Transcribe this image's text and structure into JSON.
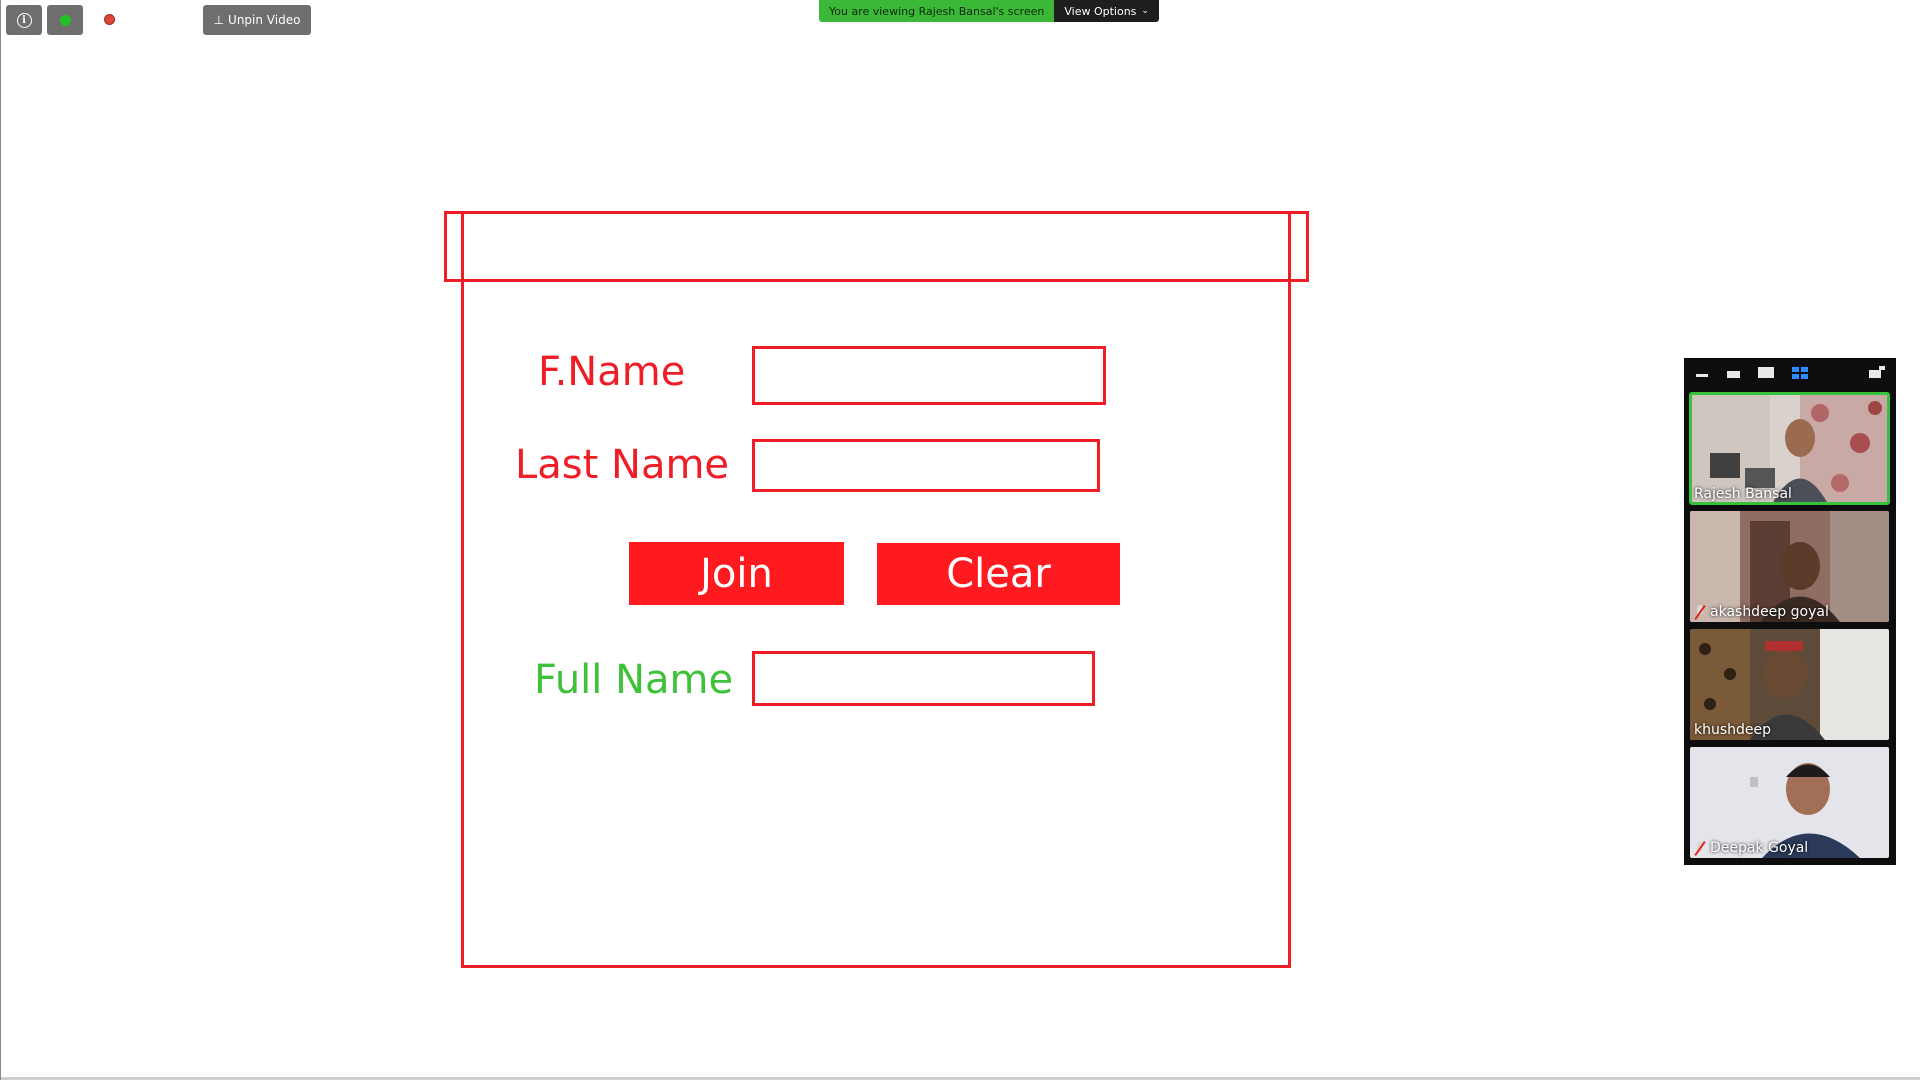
{
  "toolbar": {
    "info_icon": "info-icon",
    "security_icon": "shield-icon",
    "recording_icon": "recording-icon",
    "unpin_label": "Unpin Video"
  },
  "share_bar": {
    "banner_text": "You are viewing Rajesh Bansal's screen",
    "view_options_label": "View Options"
  },
  "shared_form": {
    "fname_label": "F.Name",
    "lname_label": "Last Name",
    "join_label": "Join",
    "clear_label": "Clear",
    "fullname_label": "Full Name",
    "fname_value": "",
    "lname_value": "",
    "fullname_value": ""
  },
  "gallery": {
    "participants": [
      {
        "name": "Rajesh Bansal",
        "muted": false,
        "active": true
      },
      {
        "name": "akashdeep goyal",
        "muted": true,
        "active": false
      },
      {
        "name": "khushdeep",
        "muted": false,
        "active": false
      },
      {
        "name": "Deepak Goyal",
        "muted": true,
        "active": false
      }
    ]
  },
  "colors": {
    "accent_red": "#ef1d25",
    "accent_green": "#3ec23a",
    "share_banner": "#3cb838"
  }
}
